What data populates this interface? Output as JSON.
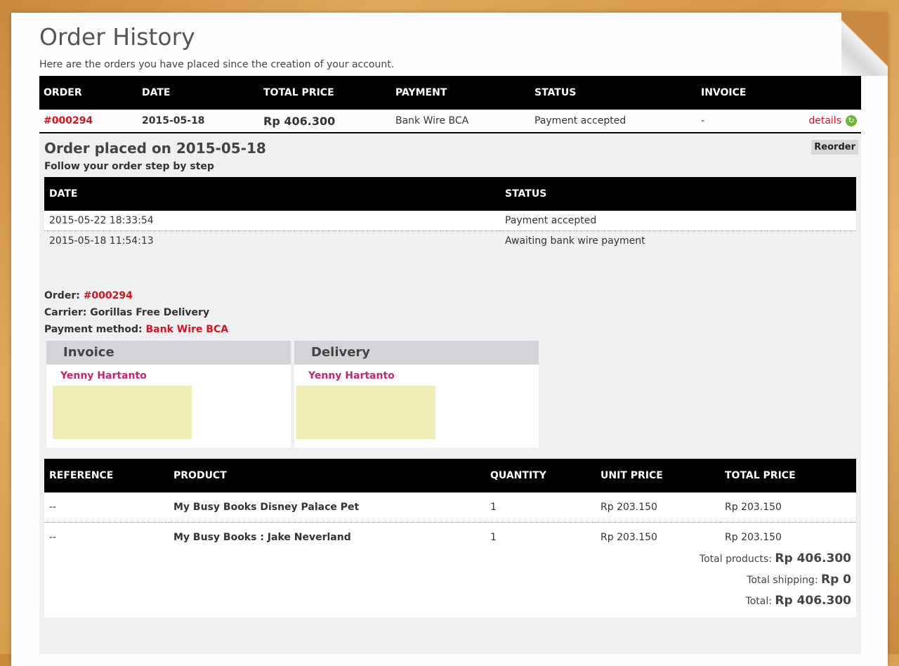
{
  "page": {
    "title": "Order History",
    "intro": "Here are the orders you have placed since the creation of your account."
  },
  "history": {
    "headers": [
      "ORDER",
      "DATE",
      "TOTAL PRICE",
      "PAYMENT",
      "STATUS",
      "INVOICE"
    ],
    "row": {
      "order": "#000294",
      "date": "2015-05-18",
      "total": "Rp 406.300",
      "payment": "Bank Wire BCA",
      "status": "Payment accepted",
      "invoice": "-",
      "details": "details"
    }
  },
  "detail": {
    "placed": "Order placed on 2015-05-18",
    "reorder": "Reorder",
    "follow": "Follow your order step by step",
    "steps_headers": [
      "DATE",
      "STATUS"
    ],
    "steps": [
      {
        "date": "2015-05-22 18:33:54",
        "status": "Payment accepted"
      },
      {
        "date": "2015-05-18 11:54:13",
        "status": "Awaiting bank wire payment"
      }
    ],
    "order_label": "Order: ",
    "order_value": "#000294",
    "carrier": "Carrier: Gorillas Free Delivery",
    "payment_label": "Payment method: ",
    "payment_value": "Bank Wire BCA",
    "invoice_title": "Invoice",
    "invoice_name": "Yenny Hartanto",
    "delivery_title": "Delivery",
    "delivery_name": "Yenny Hartanto"
  },
  "products": {
    "headers": [
      "REFERENCE",
      "PRODUCT",
      "QUANTITY",
      "UNIT PRICE",
      "TOTAL PRICE"
    ],
    "rows": [
      {
        "ref": "--",
        "name": "My Busy Books Disney Palace Pet",
        "qty": "1",
        "unit": "Rp 203.150",
        "total": "Rp 203.150"
      },
      {
        "ref": "--",
        "name": "My Busy Books : Jake Neverland",
        "qty": "1",
        "unit": "Rp 203.150",
        "total": "Rp 203.150"
      }
    ],
    "total_products_label": "Total products: ",
    "total_products": "Rp 406.300",
    "total_shipping_label": "Total shipping: ",
    "total_shipping": "Rp 0",
    "total_label": "Total: ",
    "total": "Rp 406.300"
  },
  "colors": {
    "accent": "#d9131e",
    "name": "#c4266c",
    "header_bg": "#000000",
    "panel_bg": "#eef0f2"
  },
  "icons": {
    "reorder": "refresh-icon"
  }
}
